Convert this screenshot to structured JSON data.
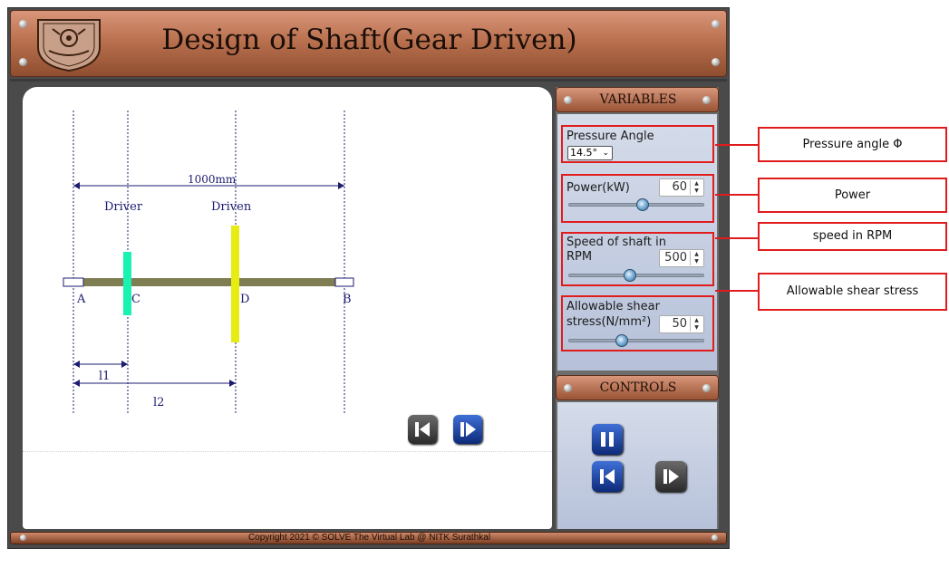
{
  "app": {
    "title": "Design of Shaft(Gear Driven)",
    "footer": "Copyright 2021 © SOLVE The Virtual Lab @ NITK Surathkal"
  },
  "diagram": {
    "dimension_label": "1000mm",
    "driver_label": "Driver",
    "driven_label": "Driven",
    "point_a": "A",
    "point_c": "C",
    "point_d": "D",
    "point_b": "B",
    "l1_label": "l1",
    "l2_label": "l2",
    "colors": {
      "shaft": "#7f7d52",
      "driver_gear": "#19f2b0",
      "driven_gear": "#e7ec12",
      "dimension": "#1c1c70"
    }
  },
  "variables": {
    "header": "VARIABLES",
    "pressure_angle": {
      "label": "Pressure Angle",
      "value": "14.5°"
    },
    "power": {
      "label": "Power(kW)",
      "value": "60",
      "level": 0.55
    },
    "speed": {
      "label_line1": "Speed of shaft in",
      "label_line2": "RPM",
      "value": "500",
      "level": 0.45
    },
    "shear": {
      "label_line1": "Allowable shear",
      "label_line2": "stress(N/mm²)",
      "value": "50",
      "level": 0.38
    }
  },
  "controls": {
    "header": "CONTROLS"
  },
  "annotations": {
    "pressure_angle": "Pressure angle Φ",
    "power": "Power",
    "speed": "speed in RPM",
    "shear": "Allowable shear stress"
  },
  "accent": {
    "annotation_red": "#e11c1c",
    "button_blue": "#1a3f9e"
  }
}
